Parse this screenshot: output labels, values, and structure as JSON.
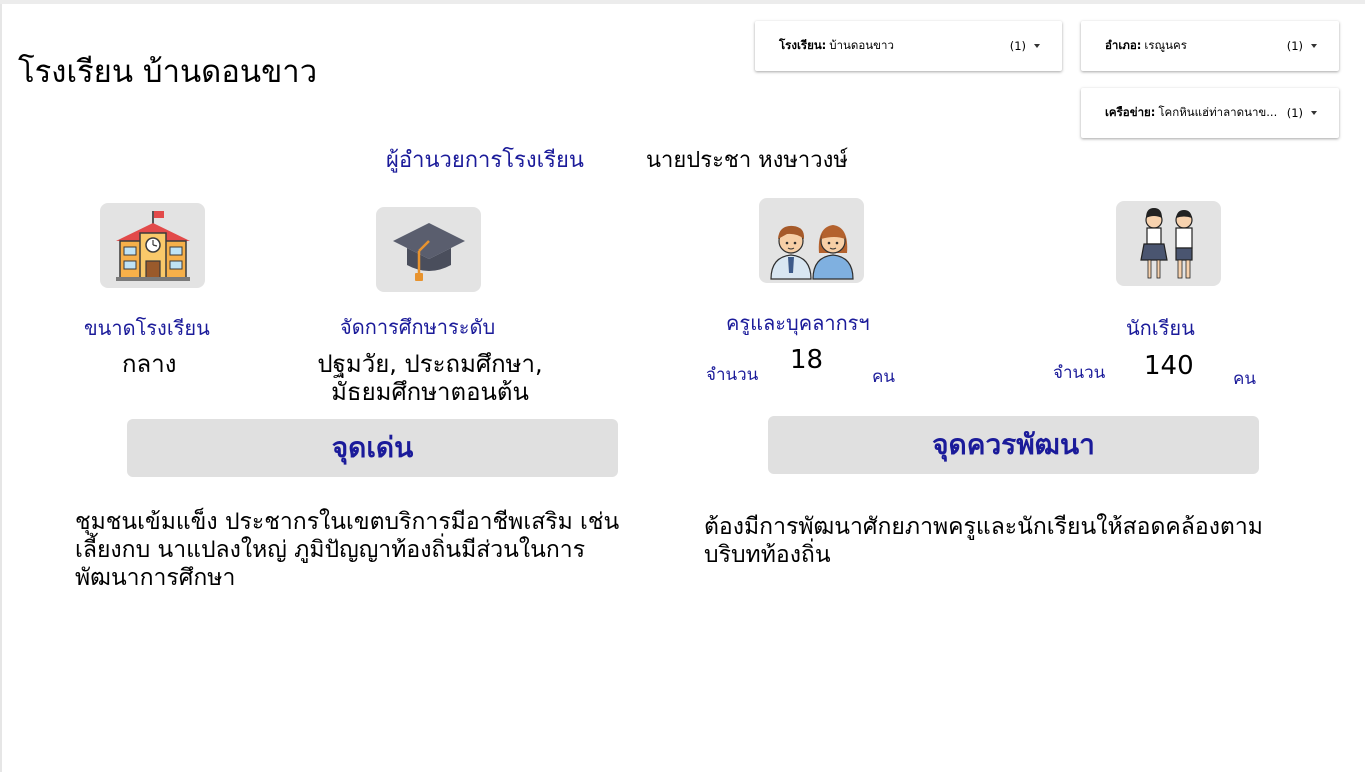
{
  "page_title": "โรงเรียน บ้านดอนขาว",
  "filters": [
    {
      "label": "โรงเรียน:",
      "value": "บ้านดอนขาว",
      "count": "(1)"
    },
    {
      "label": "อำเภอ:",
      "value": "เรณูนคร",
      "count": "(1)"
    },
    {
      "label": "เครือข่าย:",
      "value": "โคกหินแฮ่ท่าลาดนาข...",
      "count": "(1)"
    }
  ],
  "director": {
    "label": "ผู้อำนวยการโรงเรียน",
    "name": "นายประชา หงษาวงษ์"
  },
  "school_size": {
    "label": "ขนาดโรงเรียน",
    "value": "กลาง"
  },
  "education_level": {
    "label": "จัดการศึกษาระดับ",
    "value_line1": "ปฐมวัย, ประถมศึกษา,",
    "value_line2": "มัธยมศึกษาตอนต้น"
  },
  "teachers": {
    "label": "ครูและบุคลากรฯ",
    "prefix": "จำนวน",
    "count": "18",
    "unit": "คน"
  },
  "students": {
    "label": "นักเรียน",
    "prefix": "จำนวน",
    "count": "140",
    "unit": "คน"
  },
  "strengths": {
    "title": "จุดเด่น",
    "text": "ชุมชนเข้มแข็ง ประชากรในเขตบริการมีอาชีพเสริม เช่น เลี้ยงกบ นาแปลงใหญ่ ภูมิปัญญาท้องถิ่นมีส่วนในการพัฒนาการศึกษา"
  },
  "improvements": {
    "title": "จุดควรพัฒนา",
    "text": "ต้องมีการพัฒนาศักยภาพครูและนักเรียนให้สอดคล้องตามบริบทท้องถิ่น"
  },
  "icons": {
    "school": "school-building-icon",
    "education": "graduation-cap-icon",
    "teachers": "teachers-icon",
    "students": "students-icon"
  },
  "colors": {
    "accent": "#1b1b9a",
    "card_bg": "#e0e0e0"
  }
}
